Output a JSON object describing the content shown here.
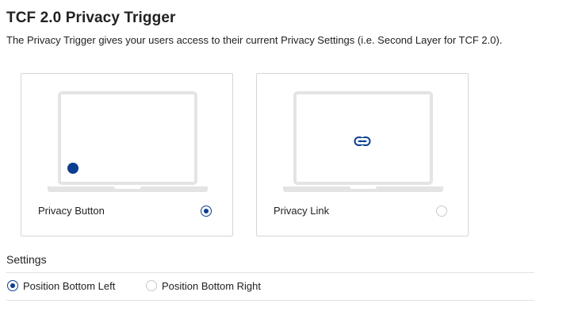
{
  "header": {
    "title": "TCF 2.0 Privacy Trigger",
    "description": "The Privacy Trigger gives your users access to their current Privacy Settings (i.e. Second Layer for TCF 2.0)."
  },
  "trigger_options": [
    {
      "label": "Privacy Button",
      "selected": true,
      "preview_icon": "dot-button-icon"
    },
    {
      "label": "Privacy Link",
      "selected": false,
      "preview_icon": "link-icon"
    }
  ],
  "settings": {
    "heading": "Settings",
    "position_options": [
      {
        "label": "Position Bottom Left",
        "selected": true
      },
      {
        "label": "Position Bottom Right",
        "selected": false
      }
    ]
  },
  "colors": {
    "accent": "#0b3e91",
    "laptop_outline": "#e4e4e4",
    "card_border": "#d6d6d6"
  }
}
